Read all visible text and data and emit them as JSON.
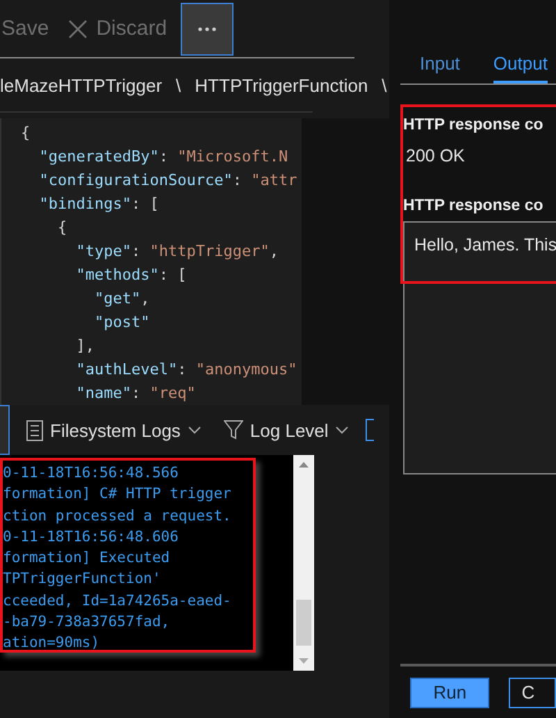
{
  "toolbar": {
    "save": "Save",
    "discard": "Discard"
  },
  "breadcrumb": [
    "leMazeHTTPTrigger",
    "\\",
    "HTTPTriggerFunction",
    "\\"
  ],
  "editor": {
    "lines": [
      [
        {
          "kind": "punc",
          "text": "{"
        }
      ],
      [
        {
          "kind": "key",
          "text": "  \"generatedBy\""
        },
        {
          "kind": "punc",
          "text": ": "
        },
        {
          "kind": "str",
          "text": "\"Microsoft.N"
        }
      ],
      [
        {
          "kind": "key",
          "text": "  \"configurationSource\""
        },
        {
          "kind": "punc",
          "text": ": "
        },
        {
          "kind": "str",
          "text": "\"attr"
        }
      ],
      [
        {
          "kind": "key",
          "text": "  \"bindings\""
        },
        {
          "kind": "punc",
          "text": ": ["
        }
      ],
      [
        {
          "kind": "punc",
          "text": "    {"
        }
      ],
      [
        {
          "kind": "key",
          "text": "      \"type\""
        },
        {
          "kind": "punc",
          "text": ": "
        },
        {
          "kind": "str",
          "text": "\"httpTrigger\""
        },
        {
          "kind": "punc",
          "text": ","
        }
      ],
      [
        {
          "kind": "key",
          "text": "      \"methods\""
        },
        {
          "kind": "punc",
          "text": ": ["
        }
      ],
      [
        {
          "kind": "key",
          "text": "        \"get\""
        },
        {
          "kind": "punc",
          "text": ","
        }
      ],
      [
        {
          "kind": "key",
          "text": "        \"post\""
        }
      ],
      [
        {
          "kind": "punc",
          "text": "      ],"
        }
      ],
      [
        {
          "kind": "key",
          "text": "      \"authLevel\""
        },
        {
          "kind": "punc",
          "text": ": "
        },
        {
          "kind": "str",
          "text": "\"anonymous\""
        }
      ],
      [
        {
          "kind": "key",
          "text": "      \"name\""
        },
        {
          "kind": "punc",
          "text": ": "
        },
        {
          "kind": "str",
          "text": "\"req\""
        }
      ]
    ]
  },
  "log_toolbar": {
    "source": "Filesystem Logs",
    "level": "Log Level"
  },
  "log": [
    "0-11-18T16:56:48.566",
    "formation] C# HTTP trigger",
    "ction processed a request.",
    "0-11-18T16:56:48.606",
    "formation] Executed",
    "TPTriggerFunction'",
    "cceeded, Id=1a74265a-eaed-",
    "-ba79-738a37657fad,",
    "ation=90ms)"
  ],
  "tabs": [
    {
      "label": "Input",
      "selected": false
    },
    {
      "label": "Output",
      "selected": true
    }
  ],
  "output": {
    "status_label": "HTTP response co",
    "status_value": "200 OK",
    "body_label": "HTTP response co",
    "body_value": "Hello, James. This"
  },
  "buttons": [
    {
      "label": "Run",
      "kind": "primary"
    },
    {
      "label": "C",
      "kind": "secondary"
    }
  ]
}
